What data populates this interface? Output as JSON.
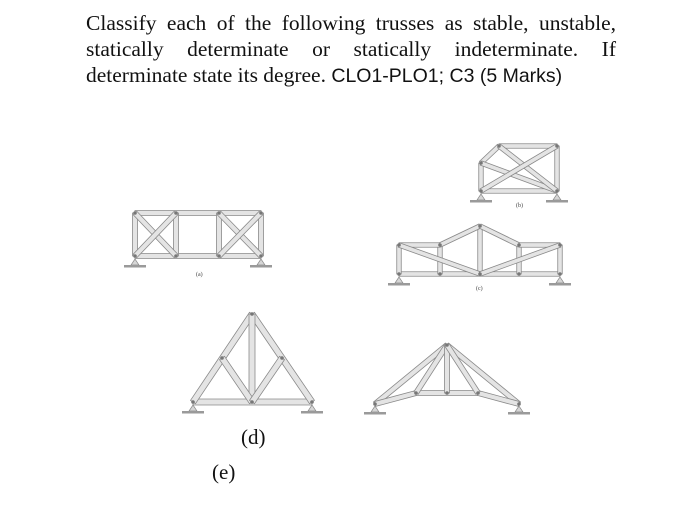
{
  "question": {
    "line1": "Classify each of the following trusses as stable, unstable,",
    "line2": "statically determinate or statically indeterminate. If",
    "line3_text": "determinate state its degree.",
    "line3_tag": "CLO1-PLO1; C3 (5 Marks)"
  },
  "figures": {
    "a": {
      "label": "(a)"
    },
    "b": {
      "label": "(b)"
    },
    "c": {
      "label": "(c)"
    },
    "d": {
      "label": "(d)"
    },
    "e": {
      "label": "(e)"
    }
  },
  "colors": {
    "member_fill": "#e4e4e4",
    "member_stroke": "#8a8a8a",
    "pin": "#777777",
    "ground": "#9a9a9a"
  }
}
